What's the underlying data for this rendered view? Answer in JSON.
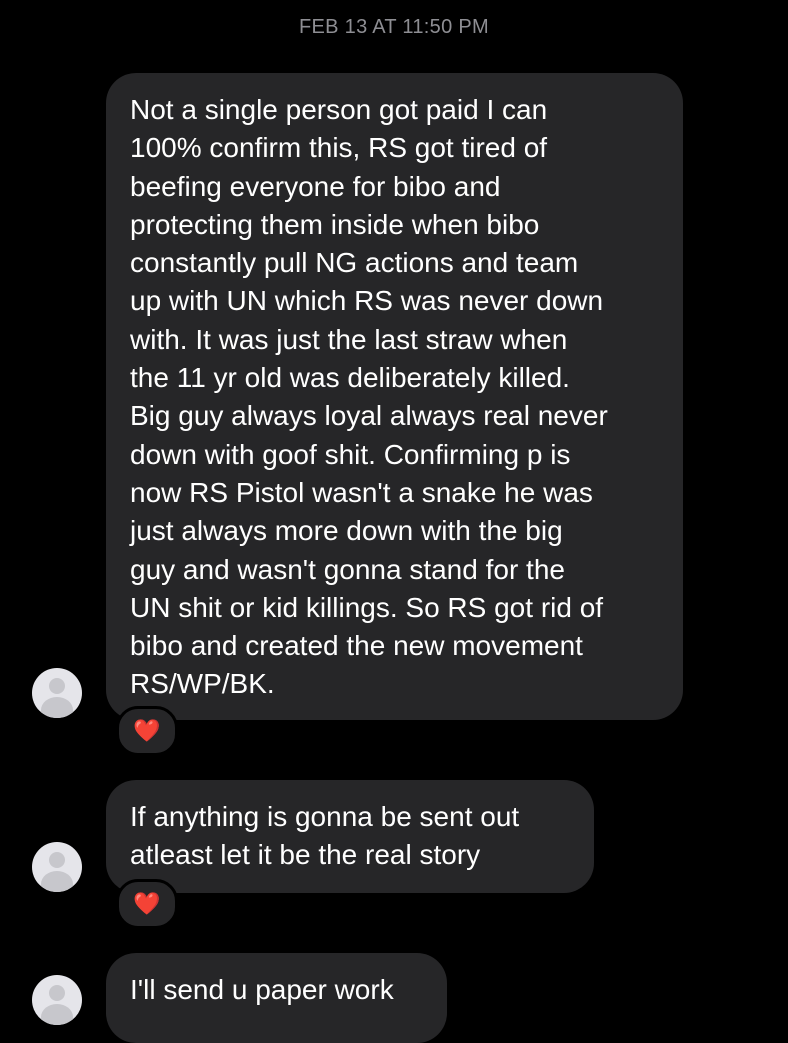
{
  "header": {
    "timestamp": "FEB 13 AT 11:50 PM"
  },
  "messages": [
    {
      "text": "Not a single person got paid I can\n100%  confirm this, RS got tired of\nbeefing everyone for bibo and\nprotecting them inside when bibo\nconstantly pull NG actions and team\nup with UN which RS was never down\nwith. It was just the last straw when\nthe 11 yr old was deliberately killed.\nBig guy always loyal always real never\ndown with goof shit. Confirming p is\nnow RS Pistol wasn't a snake he was\njust always more down with the big\nguy and wasn't gonna stand for the\nUN shit or kid killings. So RS got rid of\nbibo and created the new movement\nRS/WP/BK.",
      "reaction": "❤️"
    },
    {
      "text": "If anything is gonna be sent out\natleast let it be the real story",
      "reaction": "❤️"
    },
    {
      "text": "I'll send u paper work",
      "reaction": null
    }
  ],
  "colors": {
    "background": "#000000",
    "bubble": "#262628",
    "timestamp": "#8e8e93",
    "text": "#ffffff",
    "heart": "#ff2d45",
    "avatar": "#e5e5ea"
  },
  "icons": {
    "avatar": "default-profile-icon",
    "reaction": "red-heart-icon"
  }
}
